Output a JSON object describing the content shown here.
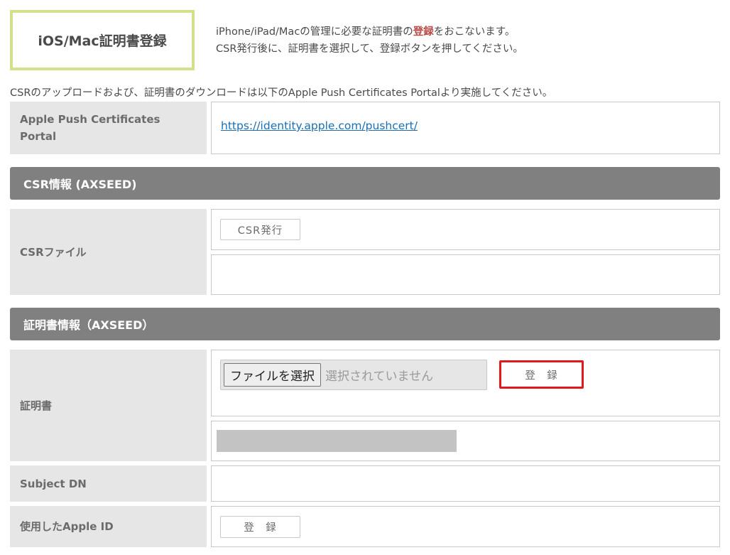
{
  "header": {
    "title": "iOS/Mac証明書登録",
    "desc_line1_pre": "iPhone/iPad/Macの管理に必要な証明書の",
    "desc_line1_highlight": "登録",
    "desc_line1_post": "をおこないます。",
    "desc_line2": "CSR発行後に、証明書を選択して、登録ボタンを押してください。"
  },
  "notice": "CSRのアップロードおよび、証明書のダウンロードは以下のApple Push Certificates Portalより実施してください。",
  "portal": {
    "label": "Apple Push Certificates Portal",
    "url": "https://identity.apple.com/pushcert/"
  },
  "csr_section": {
    "title": "CSR情報 (AXSEED)",
    "file_label": "CSRファイル",
    "issue_button": "CSR発行"
  },
  "cert_section": {
    "title": "証明書情報（AXSEED）",
    "cert_label": "証明書",
    "choose_file_button": "ファイルを選択",
    "no_file_text": "選択されていません",
    "register_button": "登　録",
    "subject_dn_label": "Subject DN",
    "apple_id_label": "使用したApple ID",
    "apple_id_register_button": "登　録"
  },
  "colors": {
    "title_border": "#d3e28a",
    "section_bar": "#808080",
    "label_bg": "#e6e6e6",
    "highlight_text": "#b94a48",
    "link": "#1a6fb3",
    "focus_border": "#e01a1a"
  }
}
